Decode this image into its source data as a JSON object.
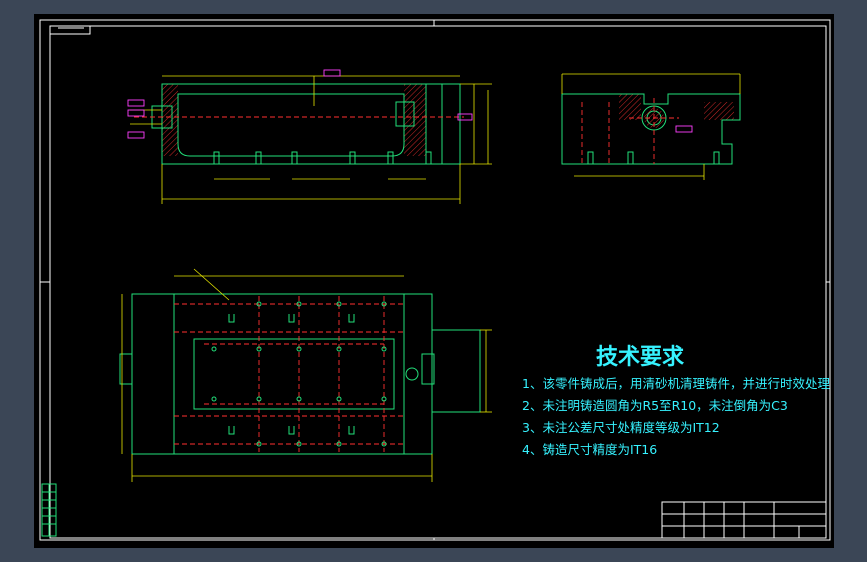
{
  "drawing": {
    "tech_requirements_title": "技术要求",
    "tech_requirements": [
      "1、该零件铸成后，用清砂机清理铸件，并进行时效处理",
      "2、未注明铸造圆角为R5至R10，未注倒角为C3",
      "3、未注公差尺寸处精度等级为IT12",
      "4、铸造尺寸精度为IT16"
    ],
    "colors": {
      "background": "#000000",
      "frame": "#ffffff",
      "outline": "#22e07a",
      "dimension": "#e6e600",
      "annotation": "#30e0ff",
      "centerline": "#ff3030",
      "tolerance": "#ff40ff",
      "chrome": "#3b4656"
    }
  }
}
